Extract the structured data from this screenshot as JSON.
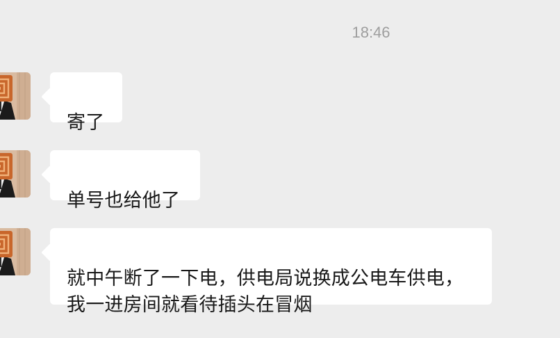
{
  "chat": {
    "timestamp": "18:46",
    "messages": [
      {
        "sender": "contact",
        "avatar_icon": "contact-avatar-icon",
        "text": "寄了"
      },
      {
        "sender": "contact",
        "avatar_icon": "contact-avatar-icon",
        "text": "单号也给他了"
      },
      {
        "sender": "contact",
        "avatar_icon": "contact-avatar-icon",
        "text": "就中午断了一下电，供电局说换成公电车供电，\n我一进房间就看待插头在冒烟"
      }
    ]
  },
  "colors": {
    "background": "#ededed",
    "bubble": "#ffffff",
    "text": "#181818",
    "timestamp": "#9e9e9e"
  }
}
